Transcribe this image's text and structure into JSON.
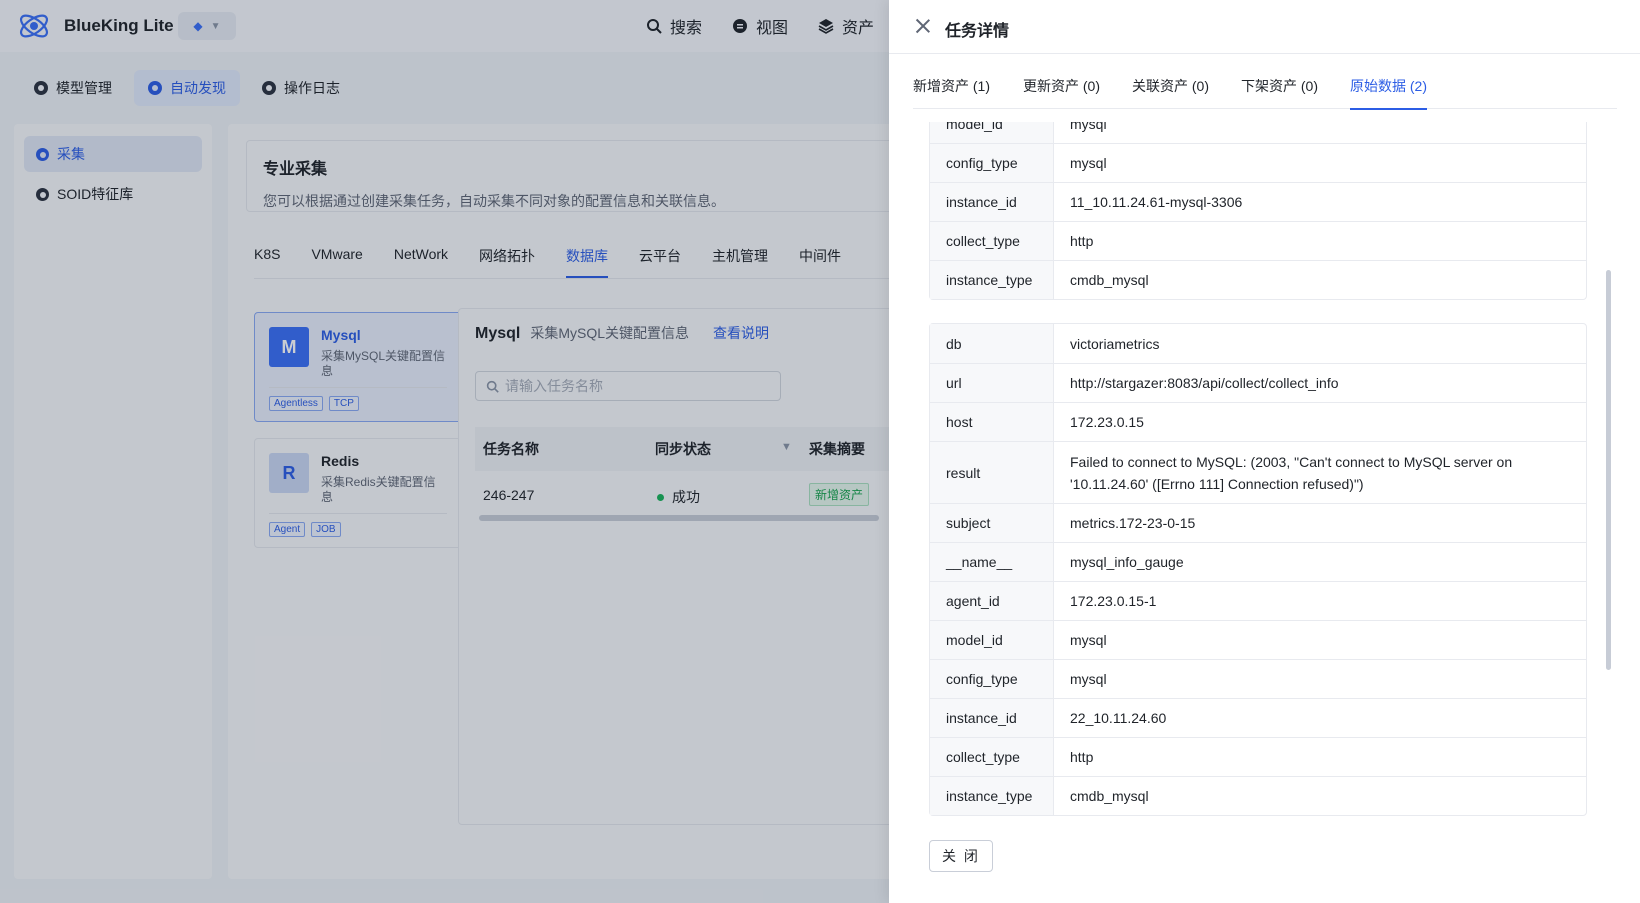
{
  "app": {
    "brand": "BlueKing Lite",
    "topnav": [
      {
        "label": "搜索",
        "icon": "search-icon"
      },
      {
        "label": "视图",
        "icon": "view-icon"
      },
      {
        "label": "资产",
        "icon": "layers-icon"
      }
    ],
    "subnav": [
      {
        "label": "模型管理",
        "active": false
      },
      {
        "label": "自动发现",
        "active": true
      },
      {
        "label": "操作日志",
        "active": false
      }
    ],
    "sidebar": [
      {
        "label": "采集",
        "active": true
      },
      {
        "label": "SOID特征库",
        "active": false
      }
    ]
  },
  "main": {
    "intro_title": "专业采集",
    "intro_desc": "您可以根据通过创建采集任务，自动采集不同对象的配置信息和关联信息。",
    "categories": [
      "K8S",
      "VMware",
      "NetWork",
      "网络拓扑",
      "数据库",
      "云平台",
      "主机管理",
      "中间件"
    ],
    "active_category": "数据库",
    "plugins": [
      {
        "avatar": "M",
        "name": "Mysql",
        "desc": "采集MySQL关键配置信息",
        "tags": [
          "Agentless",
          "TCP"
        ]
      },
      {
        "avatar": "R",
        "name": "Redis",
        "desc": "采集Redis关键配置信息",
        "tags": [
          "Agent",
          "JOB"
        ]
      }
    ],
    "task_panel": {
      "name": "Mysql",
      "desc": "采集MySQL关键配置信息",
      "link": "查看说明",
      "search_placeholder": "请输入任务名称",
      "columns": [
        "任务名称",
        "同步状态",
        "采集摘要"
      ],
      "rows": [
        {
          "name": "246-247",
          "status": "成功",
          "summary": "新增资产"
        }
      ]
    }
  },
  "drawer": {
    "title": "任务详情",
    "tabs": [
      "新增资产 (1)",
      "更新资产 (0)",
      "关联资产 (0)",
      "下架资产 (0)",
      "原始数据 (2)"
    ],
    "active_tab": 4,
    "record1": [
      {
        "key": "model_id",
        "value": "mysql"
      },
      {
        "key": "config_type",
        "value": "mysql"
      },
      {
        "key": "instance_id",
        "value": "11_10.11.24.61-mysql-3306"
      },
      {
        "key": "collect_type",
        "value": "http"
      },
      {
        "key": "instance_type",
        "value": "cmdb_mysql"
      }
    ],
    "record2": [
      {
        "key": "db",
        "value": "victoriametrics"
      },
      {
        "key": "url",
        "value": "http://stargazer:8083/api/collect/collect_info"
      },
      {
        "key": "host",
        "value": "172.23.0.15"
      },
      {
        "key": "result",
        "value": "Failed to connect to MySQL: (2003, \"Can't connect to MySQL server on '10.11.24.60' ([Errno 111] Connection refused)\")"
      },
      {
        "key": "subject",
        "value": "metrics.172-23-0-15"
      },
      {
        "key": "__name__",
        "value": "mysql_info_gauge"
      },
      {
        "key": "agent_id",
        "value": "172.23.0.15-1"
      },
      {
        "key": "model_id",
        "value": "mysql"
      },
      {
        "key": "config_type",
        "value": "mysql"
      },
      {
        "key": "instance_id",
        "value": "22_10.11.24.60"
      },
      {
        "key": "collect_type",
        "value": "http"
      },
      {
        "key": "instance_type",
        "value": "cmdb_mysql"
      }
    ],
    "close_label": "关 闭"
  }
}
